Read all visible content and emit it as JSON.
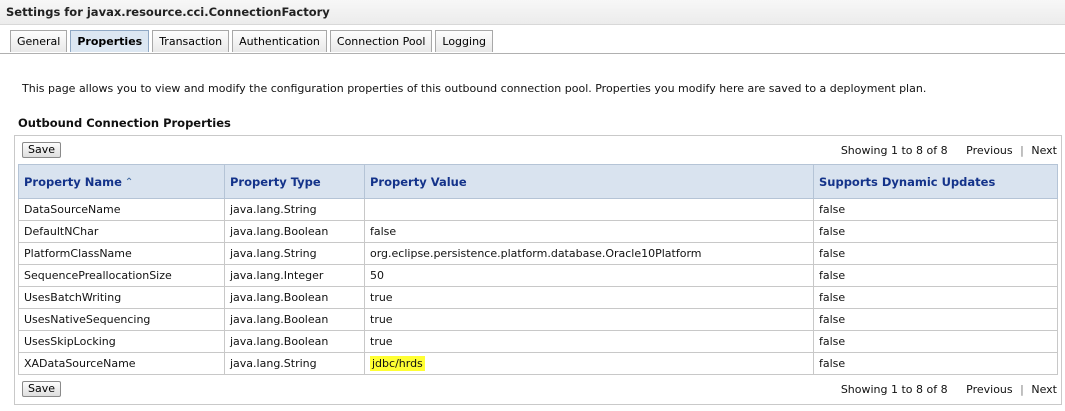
{
  "window": {
    "title": "Settings for javax.resource.cci.ConnectionFactory"
  },
  "tabs": [
    {
      "label": "General",
      "active": false
    },
    {
      "label": "Properties",
      "active": true
    },
    {
      "label": "Transaction",
      "active": false
    },
    {
      "label": "Authentication",
      "active": false
    },
    {
      "label": "Connection Pool",
      "active": false
    },
    {
      "label": "Logging",
      "active": false
    }
  ],
  "description": "This page allows you to view and modify the configuration properties of this outbound connection pool. Properties you modify here are saved to a deployment plan.",
  "section_title": "Outbound Connection Properties",
  "toolbar": {
    "save_label": "Save",
    "showing": "Showing 1 to 8 of 8",
    "previous_label": "Previous",
    "next_label": "Next"
  },
  "table": {
    "columns": [
      "Property Name",
      "Property Type",
      "Property Value",
      "Supports Dynamic Updates"
    ],
    "sorted_column_icon": "sort-ascending-icon",
    "rows": [
      {
        "name": "DataSourceName",
        "type": "java.lang.String",
        "value": "",
        "dynamic": "false",
        "highlight": false
      },
      {
        "name": "DefaultNChar",
        "type": "java.lang.Boolean",
        "value": "false",
        "dynamic": "false",
        "highlight": false
      },
      {
        "name": "PlatformClassName",
        "type": "java.lang.String",
        "value": "org.eclipse.persistence.platform.database.Oracle10Platform",
        "dynamic": "false",
        "highlight": false
      },
      {
        "name": "SequencePreallocationSize",
        "type": "java.lang.Integer",
        "value": "50",
        "dynamic": "false",
        "highlight": false
      },
      {
        "name": "UsesBatchWriting",
        "type": "java.lang.Boolean",
        "value": "true",
        "dynamic": "false",
        "highlight": false
      },
      {
        "name": "UsesNativeSequencing",
        "type": "java.lang.Boolean",
        "value": "true",
        "dynamic": "false",
        "highlight": false
      },
      {
        "name": "UsesSkipLocking",
        "type": "java.lang.Boolean",
        "value": "true",
        "dynamic": "false",
        "highlight": false
      },
      {
        "name": "XADataSourceName",
        "type": "java.lang.String",
        "value": "jdbc/hrds",
        "dynamic": "false",
        "highlight": true
      }
    ]
  },
  "colors": {
    "header_bg": "#d9e3ef",
    "header_text": "#14338a",
    "highlight": "#ffff33"
  }
}
